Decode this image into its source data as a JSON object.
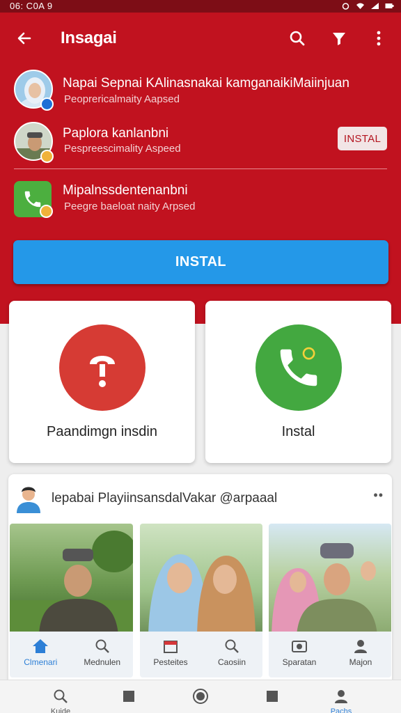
{
  "status_bar": {
    "time": "06: C0A 9"
  },
  "app_bar": {
    "title": "Insagai"
  },
  "list": [
    {
      "title": "Napai Sepnai  KAlinasnakai kamganaikiMaiinjuan",
      "subtitle": "Peoprericalmaity Aapsed"
    },
    {
      "title": "Paplora kanlanbni",
      "subtitle": "Pespreescimality Aspeed",
      "action": "INSTAL"
    },
    {
      "title": "Mipalnssdentenanbni",
      "subtitle": "Peegre baeloat naity Arpsed"
    }
  ],
  "install_button": "INSTAL",
  "cards": [
    {
      "label": "Paandimgn insdin",
      "icon": "alert-icon",
      "color": "#d63b34"
    },
    {
      "label": "Instal",
      "icon": "phone-icon",
      "color": "#43a840"
    }
  ],
  "feed": {
    "title": "lepabai PlayiinsansdalVakar @arpaaal",
    "more": "••",
    "tabs": [
      "Clmenari",
      "Mednulen",
      "Pesteites",
      "Caosiin",
      "Sparatan",
      "Majon"
    ]
  },
  "nav": {
    "items": [
      "Kuide",
      "",
      "",
      "",
      "Pachs"
    ]
  },
  "colors": {
    "brand_red": "#c1121f",
    "install_blue": "#2498e8",
    "accent_green": "#43a840"
  }
}
